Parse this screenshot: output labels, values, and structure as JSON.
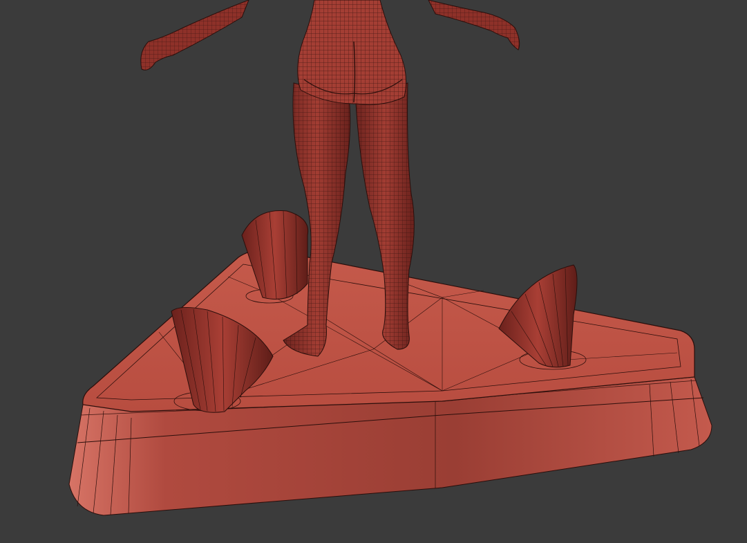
{
  "viewport": {
    "background": "#3b3b3b",
    "subject": "wireframe-figure-on-triangular-base"
  },
  "colors": {
    "clay_dark": "#7a2a24",
    "clay_mid": "#9c3a30",
    "clay_light": "#c4574a",
    "clay_highlight": "#d66a5c",
    "wire": "#2a0e0b"
  },
  "icons": [
    "sculpt-figure",
    "triangular-base",
    "cone-peg"
  ]
}
